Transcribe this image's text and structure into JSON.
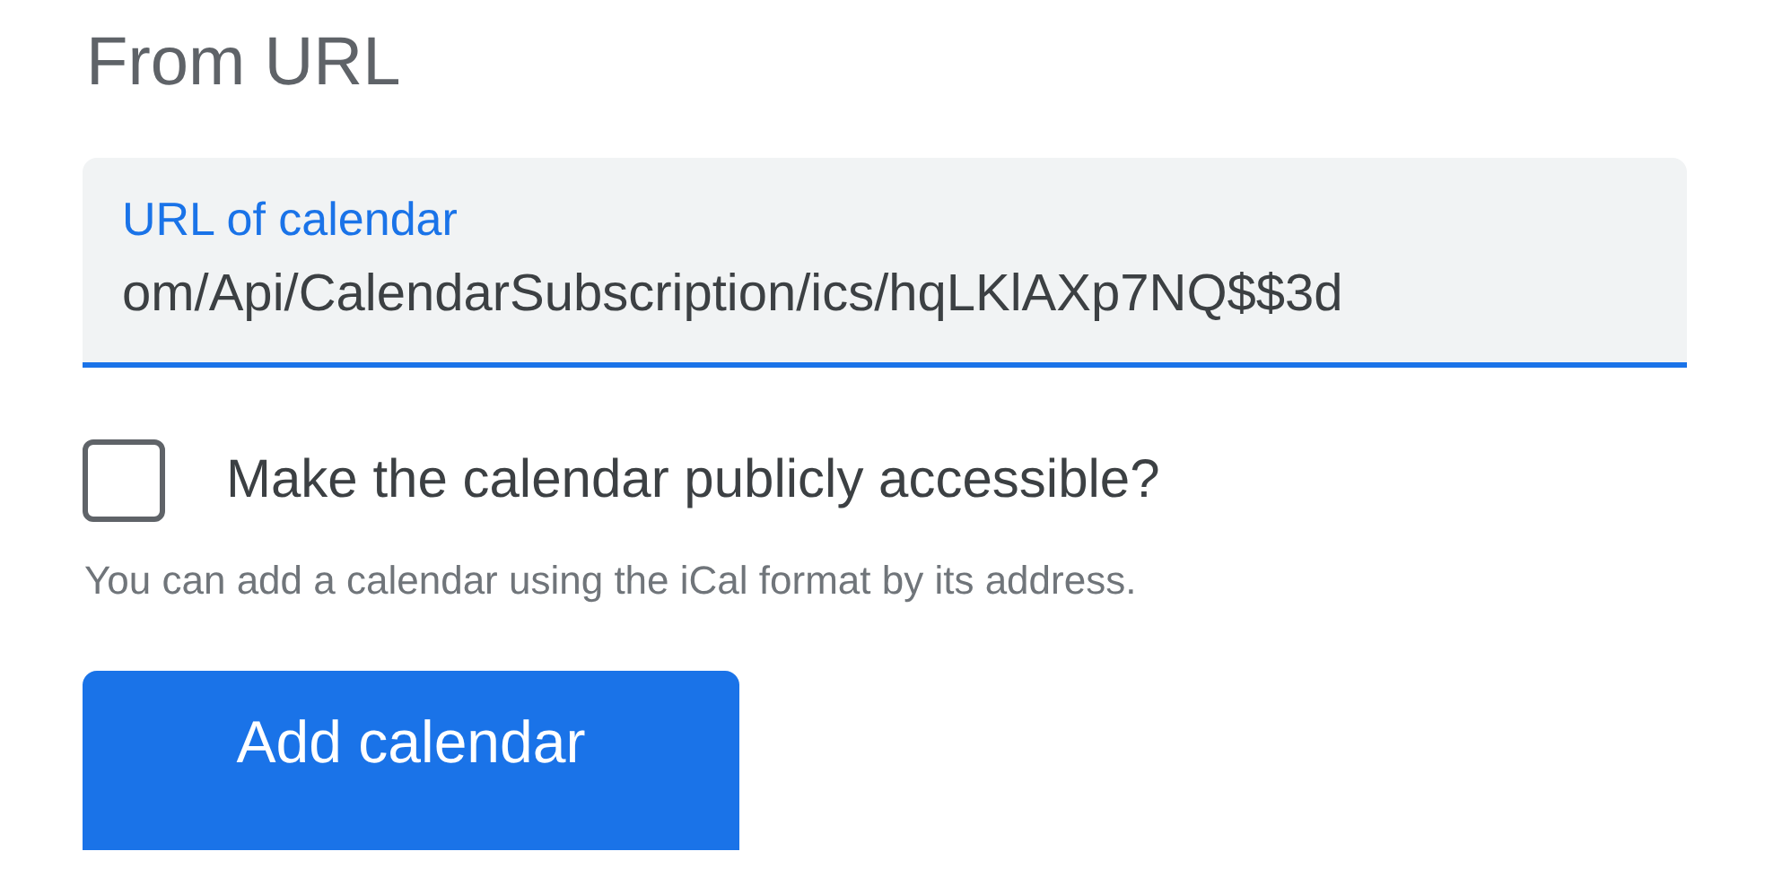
{
  "title": "From URL",
  "url_field": {
    "label": "URL of calendar",
    "value": "om/Api/CalendarSubscription/ics/hqLKlAXp7NQ$$3d",
    "focused": true
  },
  "public_checkbox": {
    "label": "Make the calendar publicly accessible?",
    "checked": false
  },
  "helper_text": "You can add a calendar using the iCal format by its address.",
  "submit_button": {
    "label": "Add calendar"
  }
}
